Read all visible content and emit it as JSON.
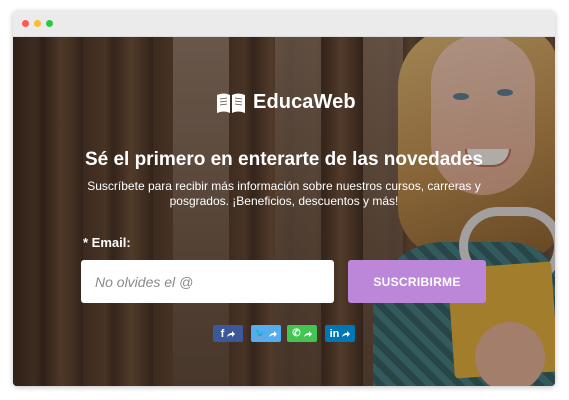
{
  "window": {
    "controls": [
      "close",
      "minimize",
      "zoom"
    ]
  },
  "brand": {
    "name": "EducaWeb",
    "icon": "open-book-icon"
  },
  "headline": "Sé el primero en enterarte de las novedades",
  "subtitle": "Suscríbete para recibir más información sobre nuestros cursos, carreras y posgrados. ¡Beneficios, descuentos y más!",
  "form": {
    "email_label": "* Email:",
    "email_placeholder": "No olvides el @",
    "email_value": "",
    "submit_label": "SUSCRIBIRME"
  },
  "share": [
    {
      "network": "facebook",
      "icon": "facebook-share-icon",
      "glyph": "f",
      "color": "#3b5998"
    },
    {
      "network": "twitter",
      "icon": "twitter-share-icon",
      "glyph": "🐦",
      "color": "#55acee"
    },
    {
      "network": "whatsapp",
      "icon": "whatsapp-share-icon",
      "glyph": "✆",
      "color": "#43c553"
    },
    {
      "network": "linkedin",
      "icon": "linkedin-share-icon",
      "glyph": "in",
      "color": "#0077b5"
    }
  ],
  "colors": {
    "accent": "#bc86d9",
    "text": "#ffffff"
  }
}
